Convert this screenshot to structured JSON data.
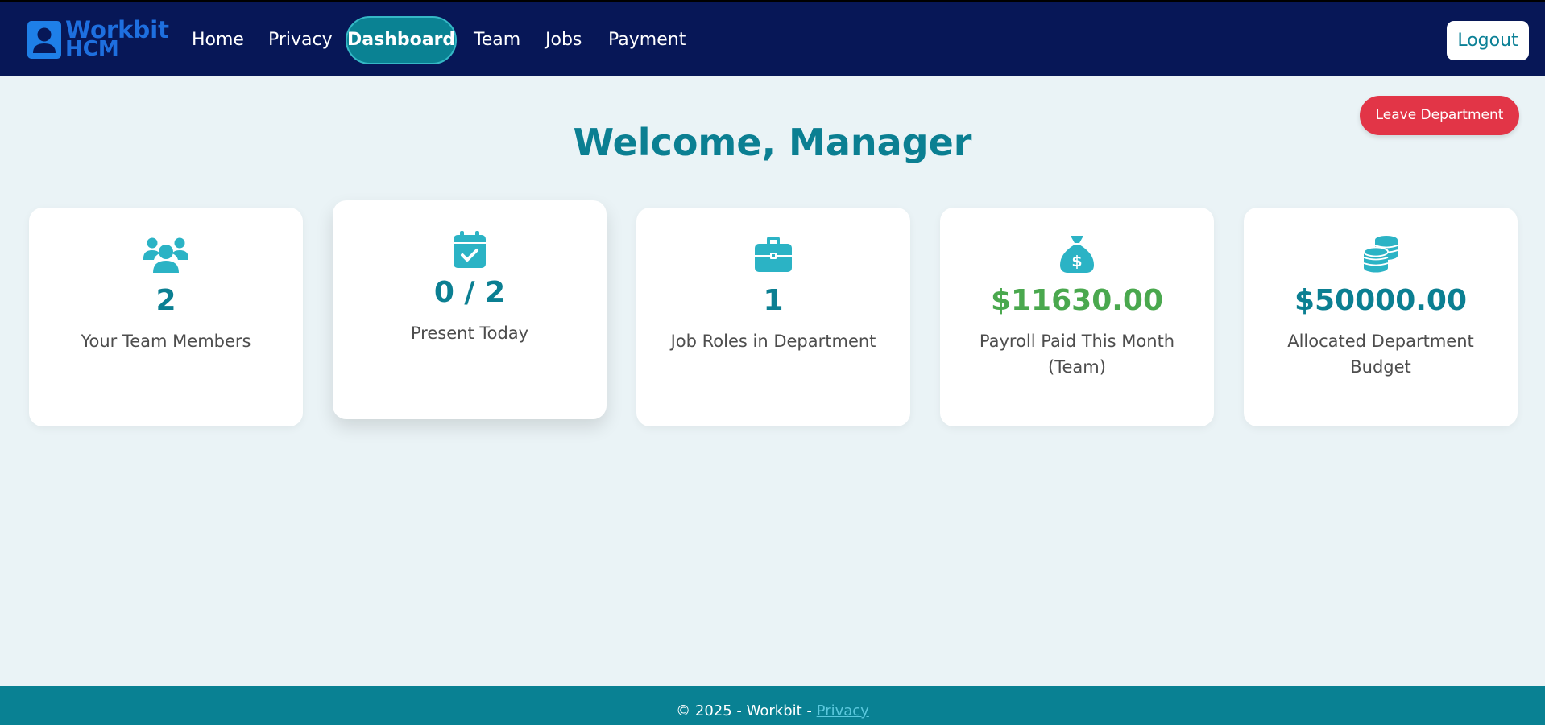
{
  "brand": {
    "line1": "Workbit",
    "line2": "HCM",
    "icon": "user-badge-icon"
  },
  "nav": {
    "items": [
      {
        "label": "Home"
      },
      {
        "label": "Privacy"
      },
      {
        "label": "Dashboard",
        "active": true
      },
      {
        "label": "Team"
      },
      {
        "label": "Jobs"
      },
      {
        "label": "Payment"
      }
    ],
    "logout_label": "Logout"
  },
  "actions": {
    "leave_department_label": "Leave Department"
  },
  "welcome": {
    "title": "Welcome, Manager"
  },
  "cards": [
    {
      "icon": "users-icon",
      "value": "2",
      "label": "Your Team Members"
    },
    {
      "icon": "calendar-check-icon",
      "value": "0 / 2",
      "label": "Present Today"
    },
    {
      "icon": "briefcase-icon",
      "value": "1",
      "label": "Job Roles in Department"
    },
    {
      "icon": "money-bag-icon",
      "value": "$11630.00",
      "label": "Payroll Paid This Month (Team)",
      "value_color": "#4aa84e"
    },
    {
      "icon": "coins-icon",
      "value": "$50000.00",
      "label": "Allocated Department Budget"
    }
  ],
  "footer": {
    "text": "© 2025 - Workbit - ",
    "link_label": "Privacy"
  },
  "colors": {
    "navbar": "#071757",
    "accent": "#0b7f92",
    "icon": "#2bb3c5",
    "danger": "#e23547",
    "success": "#4aa84e",
    "background": "#eaf3f6"
  }
}
